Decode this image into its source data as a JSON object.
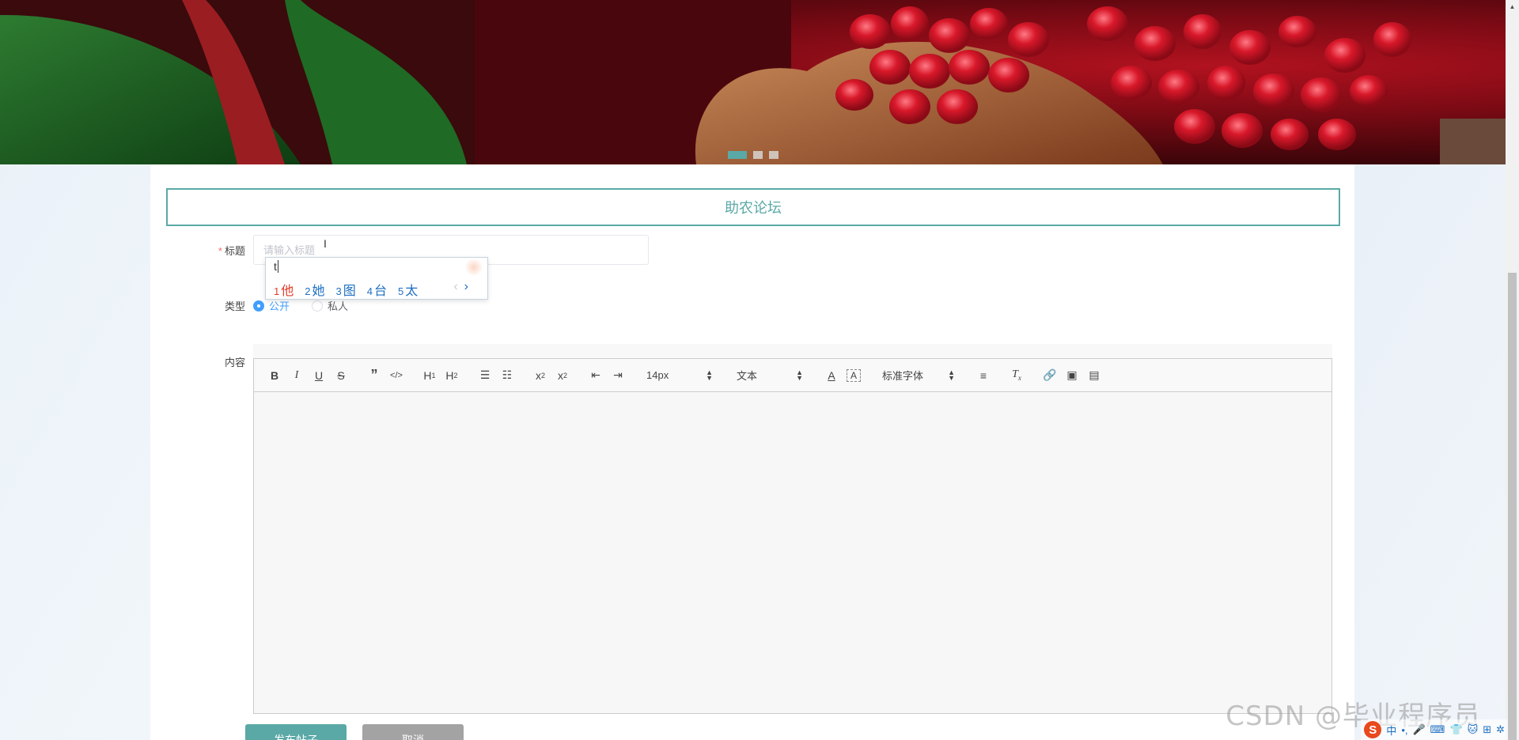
{
  "banner": {
    "slides": [
      "slide-1",
      "slide-2",
      "slide-3"
    ],
    "active_slide": 0
  },
  "forum": {
    "title": "助农论坛"
  },
  "form": {
    "title_label": "标题",
    "required_mark": "*",
    "title_placeholder": "请输入标题",
    "type_label": "类型",
    "type_options": [
      "公开",
      "私人"
    ],
    "type_selected": "公开",
    "content_label": "内容"
  },
  "ime": {
    "typed": "t",
    "candidates": [
      {
        "num": "1",
        "char": "他"
      },
      {
        "num": "2",
        "char": "她"
      },
      {
        "num": "3",
        "char": "图"
      },
      {
        "num": "4",
        "char": "台"
      },
      {
        "num": "5",
        "char": "太"
      }
    ],
    "prev": "‹",
    "next": "›"
  },
  "editor": {
    "font_size": "14px",
    "paragraph": "文本",
    "font_family": "标准字体"
  },
  "buttons": {
    "publish": "发布帖子",
    "cancel": "取消"
  },
  "watermark": "CSDN @毕业程序员",
  "tray": {
    "logo": "S",
    "items": [
      "中",
      "•,",
      "🎤",
      "⌨",
      "👕",
      "🐱",
      "⊞",
      "✲"
    ]
  },
  "colors": {
    "accent": "#5aa9a6",
    "radio_active": "#409eff",
    "required": "#f56c6c"
  }
}
